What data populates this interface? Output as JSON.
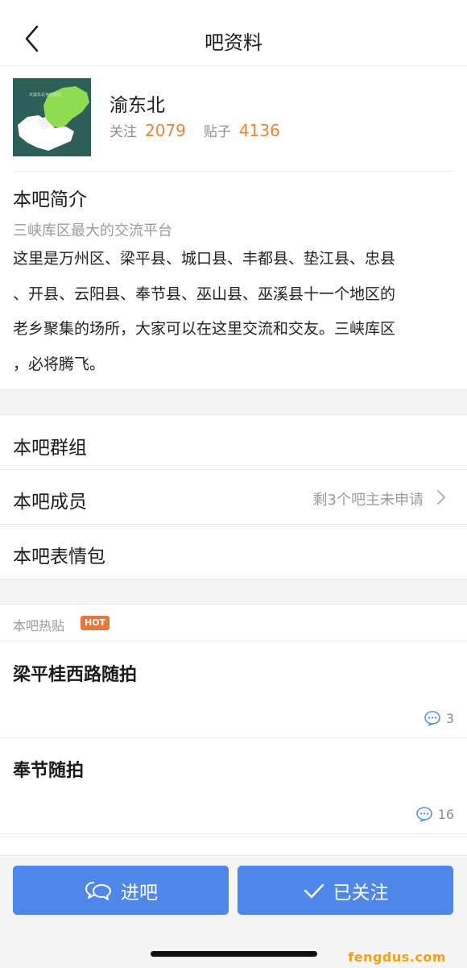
{
  "header": {
    "title": "吧资料"
  },
  "forum": {
    "name": "渝东北",
    "avatar_caption": "大渝东北平台欢迎",
    "followers_label": "关注",
    "followers": "2079",
    "posts_label": "贴子",
    "posts": "4136"
  },
  "intro": {
    "heading": "本吧简介",
    "subtitle": "三峡库区最大的交流平台",
    "lines": [
      "这里是万州区、梁平县、城口县、丰都县、垫江县、忠县",
      "、开县、云阳县、奉节县、巫山县、巫溪县十一个地区的",
      "老乡聚集的场所，大家可以在这里交流和交友。三峡库区",
      "，必将腾飞。"
    ]
  },
  "menu": {
    "groups_label": "本吧群组",
    "members_label": "本吧成员",
    "members_note": "剩3个吧主未申请",
    "stickers_label": "本吧表情包"
  },
  "hot": {
    "title": "本吧热贴",
    "badge": "HOT",
    "posts": [
      {
        "title": "梁平桂西路随拍",
        "comments": "3"
      },
      {
        "title": "奉节随拍",
        "comments": "16"
      }
    ]
  },
  "actions": {
    "enter_label": "进吧",
    "follow_label": "已关注"
  },
  "watermark": "fengdus.com",
  "colors": {
    "accent": "#4f86ea",
    "number": "#e98438",
    "hot_badge": "#e6763a",
    "map_green": "#8fdc52"
  }
}
